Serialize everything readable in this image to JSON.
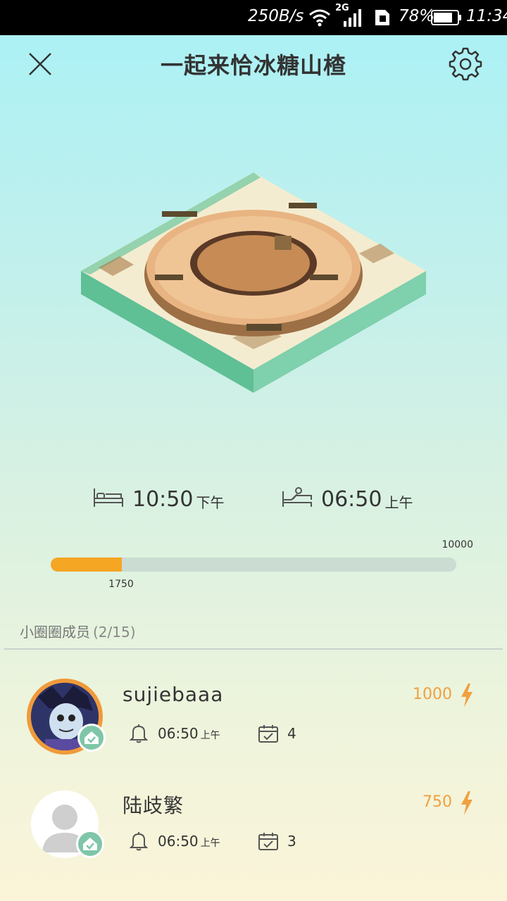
{
  "status_bar": {
    "rate": "250B/s",
    "network": "2G",
    "battery": "78%",
    "time": "11:34"
  },
  "header": {
    "title": "一起来恰冰糖山楂"
  },
  "sleep": {
    "bedtime": {
      "time": "10:50",
      "period": "下午"
    },
    "wake": {
      "time": "06:50",
      "period": "上午"
    }
  },
  "progress": {
    "current": "1750",
    "max": "10000",
    "fraction": 0.175
  },
  "members_section": {
    "label": "小圈圈成员",
    "count": "(2/15)"
  },
  "members": [
    {
      "name": "sujiebaaa",
      "score": "1000",
      "alarm_time": "06:50",
      "alarm_period": "上午",
      "checkins": "4"
    },
    {
      "name": "陆歧繁",
      "score": "750",
      "alarm_time": "06:50",
      "alarm_period": "上午",
      "checkins": "3"
    }
  ],
  "colors": {
    "accent": "#f5a623",
    "badge": "#7fc6a8",
    "score": "#f0a040"
  },
  "icons": [
    "close-icon",
    "gear-icon",
    "bed-icon",
    "wake-up-icon",
    "bell-icon",
    "calendar-check-icon",
    "lightning-icon",
    "home-badge-icon"
  ]
}
